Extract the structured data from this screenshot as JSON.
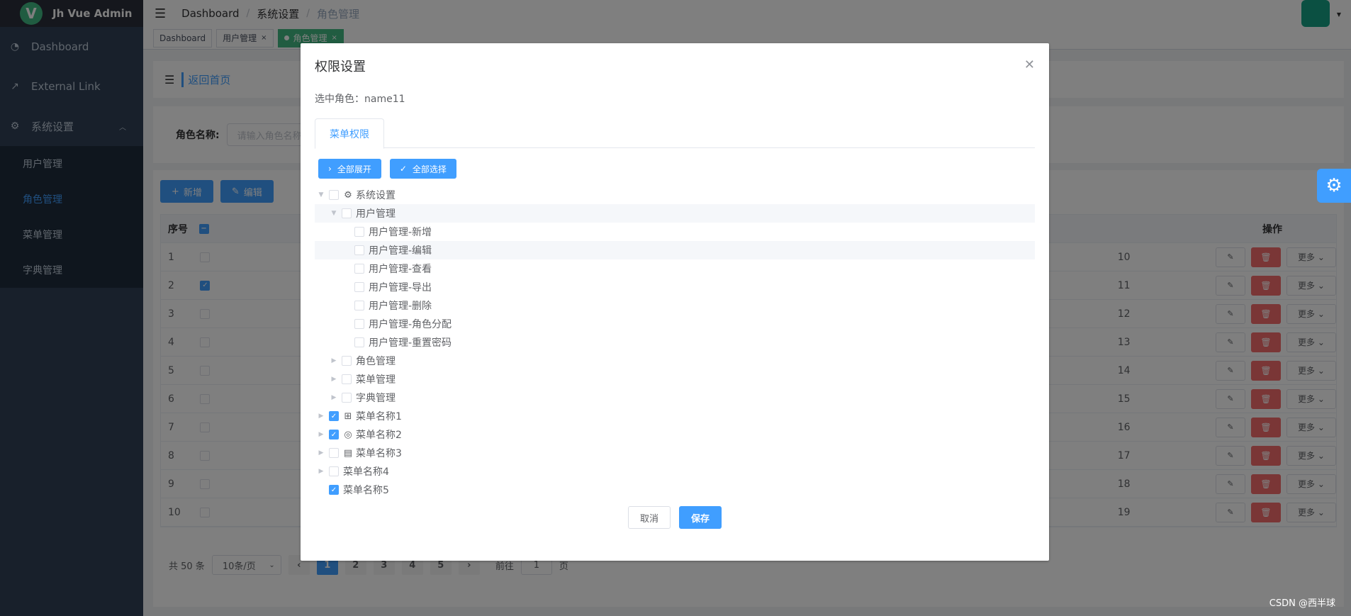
{
  "app": {
    "title": "Jh Vue Admin",
    "logo_letter": "V"
  },
  "sidebar": {
    "items": [
      {
        "label": "Dashboard",
        "icon": "dashboard-icon"
      },
      {
        "label": "External Link",
        "icon": "external-link-icon"
      },
      {
        "label": "系统设置",
        "icon": "gear-icon"
      }
    ],
    "submenu": [
      {
        "label": "用户管理"
      },
      {
        "label": "角色管理",
        "active": true
      },
      {
        "label": "菜单管理"
      },
      {
        "label": "字典管理"
      }
    ]
  },
  "breadcrumb": {
    "items": [
      "Dashboard",
      "系统设置"
    ],
    "current": "角色管理"
  },
  "tags": [
    {
      "label": "Dashboard"
    },
    {
      "label": "用户管理",
      "close": "×"
    },
    {
      "label": "角色管理",
      "close": "×",
      "active": true
    }
  ],
  "back": {
    "label": "返回首页"
  },
  "search": {
    "label": "角色名称:",
    "placeholder": "请输入角色名称"
  },
  "toolbar": {
    "add": "新增",
    "edit": "编辑"
  },
  "table": {
    "headers": {
      "index": "序号",
      "ops": "操作"
    },
    "rows": [
      {
        "idx": "1",
        "val": "10",
        "checked": false
      },
      {
        "idx": "2",
        "val": "11",
        "checked": true
      },
      {
        "idx": "3",
        "val": "12",
        "checked": false
      },
      {
        "idx": "4",
        "val": "13",
        "checked": false
      },
      {
        "idx": "5",
        "val": "14",
        "checked": false
      },
      {
        "idx": "6",
        "val": "15",
        "checked": false
      },
      {
        "idx": "7",
        "val": "16",
        "checked": false
      },
      {
        "idx": "8",
        "val": "17",
        "checked": false
      },
      {
        "idx": "9",
        "val": "18",
        "checked": false
      },
      {
        "idx": "10",
        "val": "19",
        "checked": false
      }
    ],
    "more_label": "更多"
  },
  "pagination": {
    "total": "共 50 条",
    "page_size": "10条/页",
    "pages": [
      "1",
      "2",
      "3",
      "4",
      "5"
    ],
    "current": "1",
    "goto_prefix": "前往",
    "goto_value": "1",
    "goto_suffix": "页"
  },
  "dialog": {
    "title": "权限设置",
    "selected_role": "选中角色：name11",
    "tab": "菜单权限",
    "expand_all": "全部展开",
    "select_all": "全部选择",
    "cancel": "取消",
    "save": "保存"
  },
  "tree": [
    {
      "label": "系统设置",
      "level": 0,
      "arrow": "open",
      "checked": false,
      "icon": "gear-icon"
    },
    {
      "label": "用户管理",
      "level": 1,
      "arrow": "open",
      "checked": false,
      "highlight": true
    },
    {
      "label": "用户管理-新增",
      "level": 2,
      "arrow": "none",
      "checked": false
    },
    {
      "label": "用户管理-编辑",
      "level": 2,
      "arrow": "none",
      "checked": false,
      "highlight": true
    },
    {
      "label": "用户管理-查看",
      "level": 2,
      "arrow": "none",
      "checked": false
    },
    {
      "label": "用户管理-导出",
      "level": 2,
      "arrow": "none",
      "checked": false
    },
    {
      "label": "用户管理-删除",
      "level": 2,
      "arrow": "none",
      "checked": false
    },
    {
      "label": "用户管理-角色分配",
      "level": 2,
      "arrow": "none",
      "checked": false
    },
    {
      "label": "用户管理-重置密码",
      "level": 2,
      "arrow": "none",
      "checked": false
    },
    {
      "label": "角色管理",
      "level": 1,
      "arrow": "closed",
      "checked": false
    },
    {
      "label": "菜单管理",
      "level": 1,
      "arrow": "closed",
      "checked": false
    },
    {
      "label": "字典管理",
      "level": 1,
      "arrow": "closed",
      "checked": false
    },
    {
      "label": "菜单名称1",
      "level": 0,
      "arrow": "closed",
      "checked": true,
      "icon": "tree-icon"
    },
    {
      "label": "菜单名称2",
      "level": 0,
      "arrow": "closed",
      "checked": true,
      "icon": "lifebuoy-icon"
    },
    {
      "label": "菜单名称3",
      "level": 0,
      "arrow": "closed",
      "checked": false,
      "icon": "document-icon"
    },
    {
      "label": "菜单名称4",
      "level": 0,
      "arrow": "closed",
      "checked": false
    },
    {
      "label": "菜单名称5",
      "level": 0,
      "arrow": "none",
      "checked": true
    }
  ],
  "watermark": "CSDN @西半球",
  "colors": {
    "primary": "#409eff",
    "danger": "#f56c6c",
    "sidebar": "#304156",
    "tag_active": "#42b983"
  }
}
